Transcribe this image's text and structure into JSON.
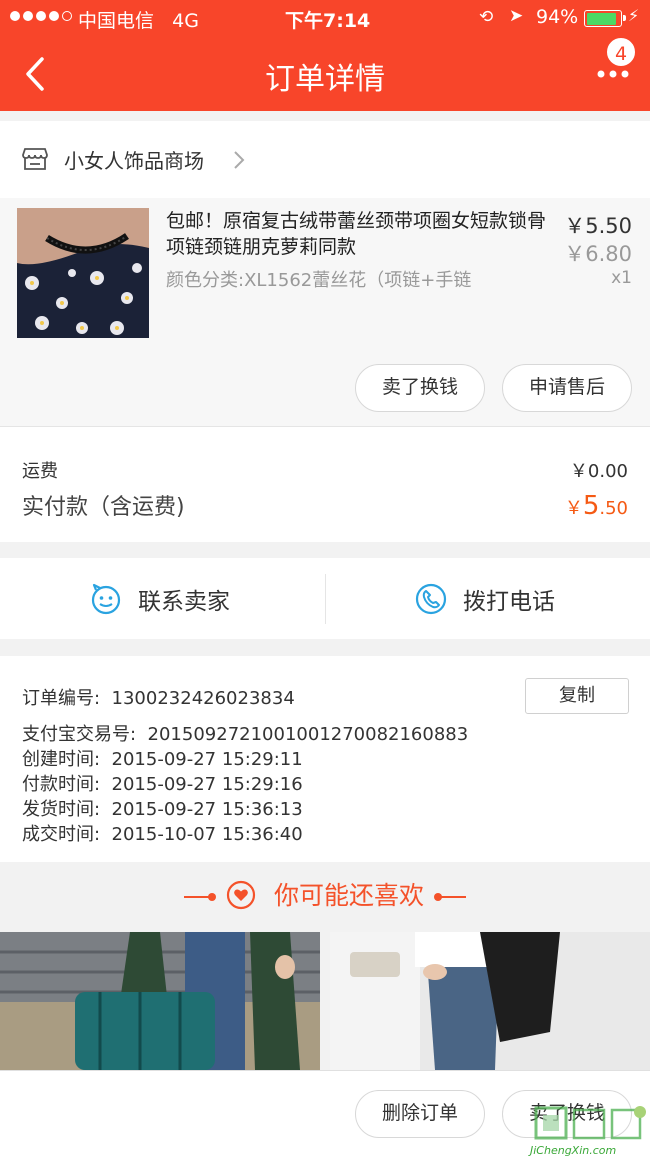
{
  "status_bar": {
    "carrier": "中国电信",
    "network": "4G",
    "time": "下午7:14",
    "battery": "94%"
  },
  "nav": {
    "title": "订单详情",
    "badge": "4"
  },
  "shop": {
    "name": "小女人饰品商场"
  },
  "product": {
    "name": "包邮！原宿复古绒带蕾丝颈带项圈女短款锁骨项链颈链朋克萝莉同款",
    "sku": "颜色分类:XL1562蕾丝花（项链+手链",
    "price": "￥5.50",
    "original_price": "￥6.80",
    "quantity": "x1",
    "sell_label": "卖了换钱",
    "aftersale_label": "申请售后"
  },
  "fees": {
    "shipping_label": "运费",
    "shipping_value": "￥0.00",
    "paid_label": "实付款（含运费)",
    "paid_currency": "￥",
    "paid_int": "5",
    "paid_dec": ".50"
  },
  "contact": {
    "seller_label": "联系卖家",
    "phone_label": "拨打电话"
  },
  "order_info": {
    "order_no_label": "订单编号:",
    "order_no": "1300232426023834",
    "copy_label": "复制",
    "alipay_label": "支付宝交易号:",
    "alipay_no": "2015092721001001270082160883",
    "created_label": "创建时间:",
    "created": "2015-09-27 15:29:11",
    "paid_time_label": "付款时间:",
    "paid_time": "2015-09-27 15:29:16",
    "shipped_label": "发货时间:",
    "shipped": "2015-09-27 15:36:13",
    "done_label": "成交时间:",
    "done": "2015-10-07 15:36:40"
  },
  "recommend": {
    "title": "你可能还喜欢"
  },
  "bottom": {
    "delete_label": "删除订单",
    "sell_label": "卖了换钱"
  },
  "watermark": {
    "url": "JiChengXin.com"
  },
  "colors": {
    "brand": "#f8452a",
    "price_accent": "#f55a14",
    "battery": "#4cd964",
    "contact_icon": "#2aa3e0"
  }
}
